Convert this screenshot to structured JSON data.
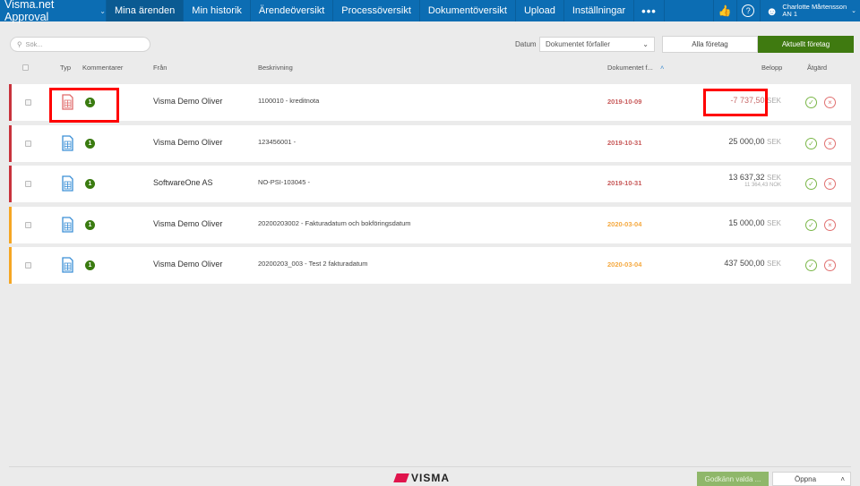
{
  "nav": {
    "brand": "Visma.net Approval",
    "tabs": [
      "Mina ärenden",
      "Min historik",
      "Ärendeöversikt",
      "Processöversikt",
      "Dokumentöversikt",
      "Upload",
      "Inställningar"
    ],
    "more": "•••",
    "user_name": "Charlotte Mårtensson",
    "user_company": "AN 1"
  },
  "search": {
    "placeholder": "Sök..."
  },
  "filter": {
    "date_label": "Datum",
    "date_value": "Dokumentet förfaller",
    "all_companies": "Alla företag",
    "current_company": "Aktuellt företag"
  },
  "columns": {
    "type": "Typ",
    "comments": "Kommentarer",
    "from": "Från",
    "description": "Beskrivning",
    "document": "Dokumentet f...",
    "amount": "Belopp",
    "action": "Åtgärd"
  },
  "rows": [
    {
      "comments": "1",
      "from": "Visma Demo Oliver",
      "description": "1100010 - kreditnota",
      "date": "2019-10-09",
      "amount": "-7 737,50",
      "currency": "SEK",
      "sub": "",
      "status": "overdue",
      "doc_type": "credit"
    },
    {
      "comments": "1",
      "from": "Visma Demo Oliver",
      "description": "123456001 -",
      "date": "2019-10-31",
      "amount": "25 000,00",
      "currency": "SEK",
      "sub": "",
      "status": "overdue",
      "doc_type": "invoice"
    },
    {
      "comments": "1",
      "from": "SoftwareOne AS",
      "description": "NO-PSI-103045 -",
      "date": "2019-10-31",
      "amount": "13 637,32",
      "currency": "SEK",
      "sub": "11 364,43 NOK",
      "status": "overdue",
      "doc_type": "invoice"
    },
    {
      "comments": "1",
      "from": "Visma Demo Oliver",
      "description": "20200203002 - Fakturadatum och bokföringsdatum",
      "date": "2020-03-04",
      "amount": "15 000,00",
      "currency": "SEK",
      "sub": "",
      "status": "due",
      "doc_type": "invoice"
    },
    {
      "comments": "1",
      "from": "Visma Demo Oliver",
      "description": "20200203_003 - Test 2 fakturadatum",
      "date": "2020-03-04",
      "amount": "437 500,00",
      "currency": "SEK",
      "sub": "",
      "status": "due",
      "doc_type": "invoice"
    }
  ],
  "footer": {
    "logo": "VISMA",
    "approve_selected": "Godkänn valda ...",
    "open": "Öppna"
  },
  "colors": {
    "nav": "#0c6db3",
    "accent_green": "#3f7a10",
    "overdue": "#c8323c",
    "due": "#f5a623"
  }
}
